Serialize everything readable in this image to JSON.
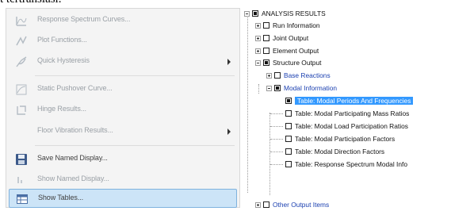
{
  "caption": "t tertranslasi.",
  "menu": {
    "items": [
      {
        "label": "Response Spectrum Curves...",
        "icon": "response-spectrum-icon",
        "enabled": false,
        "submenu": false
      },
      {
        "label": "Plot Functions...",
        "icon": "plot-functions-icon",
        "enabled": false,
        "submenu": false
      },
      {
        "label": "Quick Hysteresis",
        "icon": "hysteresis-icon",
        "enabled": false,
        "submenu": true
      },
      {
        "label": "Static Pushover Curve...",
        "icon": "pushover-curve-icon",
        "enabled": false,
        "submenu": false
      },
      {
        "label": "Hinge Results...",
        "icon": "hinge-results-icon",
        "enabled": false,
        "submenu": false
      },
      {
        "label": "Floor Vibration Results...",
        "icon": "floor-vibration-icon",
        "enabled": false,
        "submenu": true
      },
      {
        "label": "Save Named Display...",
        "icon": "save-icon",
        "enabled": true,
        "submenu": false
      },
      {
        "label": "Show Named Display...",
        "icon": "show-named-display-icon",
        "enabled": false,
        "submenu": false
      },
      {
        "label": "Show Tables...",
        "icon": "table-icon",
        "enabled": true,
        "submenu": false,
        "highlighted": true
      }
    ]
  },
  "tree": {
    "root": "ANALYSIS RESULTS",
    "run_information": "Run Information",
    "joint_output": "Joint Output",
    "element_output": "Element Output",
    "structure_output": "Structure Output",
    "base_reactions": "Base Reactions",
    "modal_information": "Modal Information",
    "tables": [
      {
        "label": "Table:  Modal Periods And Frequencies",
        "checked": true,
        "selected": true
      },
      {
        "label": "Table:  Modal Participating Mass Ratios",
        "checked": false
      },
      {
        "label": "Table:  Modal Load Participation Ratios",
        "checked": false
      },
      {
        "label": "Table:  Modal Participation Factors",
        "checked": false
      },
      {
        "label": "Table:  Modal Direction Factors",
        "checked": false
      },
      {
        "label": "Table:  Response Spectrum Modal Info",
        "checked": false
      }
    ],
    "other_output": "Other Output Items"
  },
  "colors": {
    "highlight_bg": "#cce4f7",
    "selection": "#3399ff",
    "link_blue": "#1a3fb0"
  }
}
